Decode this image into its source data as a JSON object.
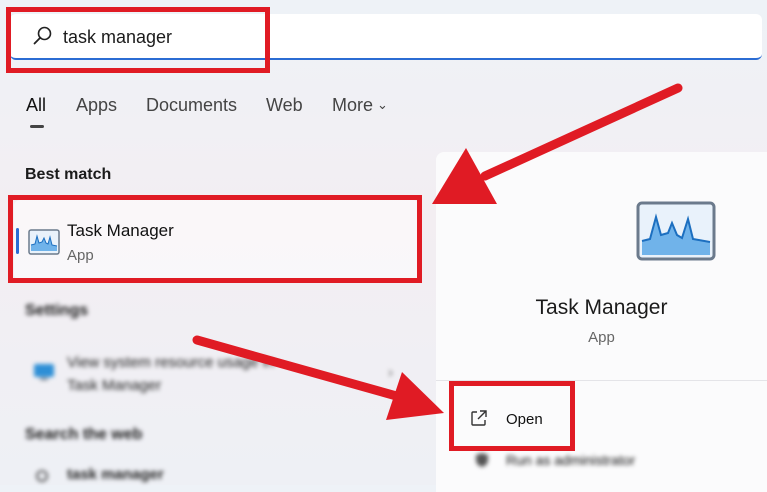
{
  "search": {
    "query": "task manager"
  },
  "tabs": [
    {
      "label": "All"
    },
    {
      "label": "Apps"
    },
    {
      "label": "Documents"
    },
    {
      "label": "Web"
    },
    {
      "label": "More"
    }
  ],
  "best_match": {
    "section_label": "Best match",
    "title": "Task Manager",
    "subtitle": "App"
  },
  "settings": {
    "section_label": "Settings",
    "item_line1": "View system resource usage in",
    "item_line2": "Task Manager"
  },
  "web": {
    "section_label": "Search the web",
    "item_text": "task manager"
  },
  "details": {
    "title": "Task Manager",
    "subtitle": "App",
    "actions": [
      {
        "label": "Open",
        "icon": "open-external-icon"
      },
      {
        "label": "Run as administrator",
        "icon": "shield-icon"
      }
    ]
  },
  "colors": {
    "accent": "#2b6cd3",
    "annotation_red": "#e01b24"
  }
}
